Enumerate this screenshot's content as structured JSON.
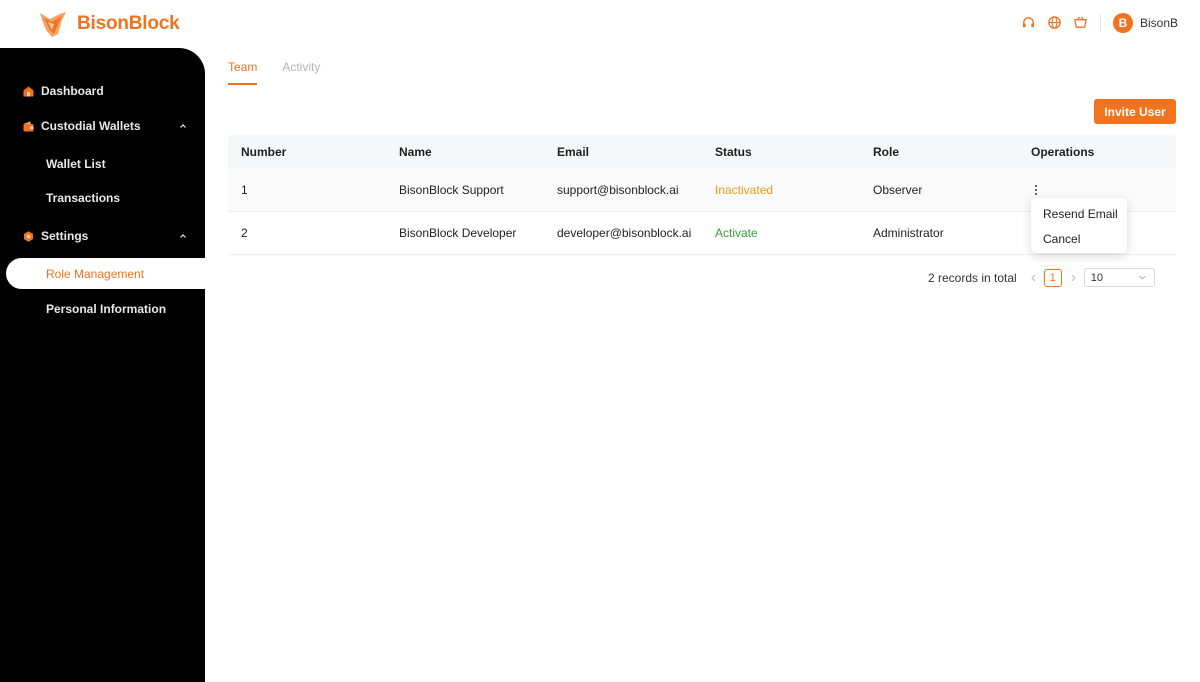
{
  "app": {
    "brand": "BisonBlock",
    "accent_color": "#f07320"
  },
  "header": {
    "icons": [
      "headset-icon",
      "globe-icon",
      "basket-icon"
    ],
    "user": {
      "avatar_letter": "B",
      "name": "BisonB"
    }
  },
  "sidebar": {
    "items": [
      {
        "label": "Dashboard",
        "icon": "home-icon"
      },
      {
        "label": "Custodial Wallets",
        "icon": "wallet-icon",
        "expanded": true
      },
      {
        "label": "Wallet List"
      },
      {
        "label": "Transactions"
      },
      {
        "label": "Settings",
        "icon": "settings-icon",
        "expanded": true
      },
      {
        "label": "Role Management",
        "active": true
      },
      {
        "label": "Personal Information"
      }
    ]
  },
  "tabs": [
    {
      "label": "Team",
      "active": true
    },
    {
      "label": "Activity",
      "active": false
    }
  ],
  "toolbar": {
    "invite_label": "Invite User"
  },
  "table": {
    "columns": [
      "Number",
      "Name",
      "Email",
      "Status",
      "Role",
      "Operations"
    ],
    "rows": [
      {
        "number": "1",
        "name": "BisonBlock Support",
        "email": "support@bisonblock.ai",
        "status": "Inactivated",
        "status_color": "#e99a1d",
        "role": "Observer"
      },
      {
        "number": "2",
        "name": "BisonBlock Developer",
        "email": "developer@bisonblock.ai",
        "status": "Activate",
        "status_color": "#3d9a3d",
        "role": "Administrator"
      }
    ]
  },
  "operations_menu": {
    "items": [
      "Resend Email",
      "Cancel"
    ]
  },
  "pagination": {
    "total_text": "2 records in total",
    "current_page": "1",
    "page_size": "10"
  }
}
